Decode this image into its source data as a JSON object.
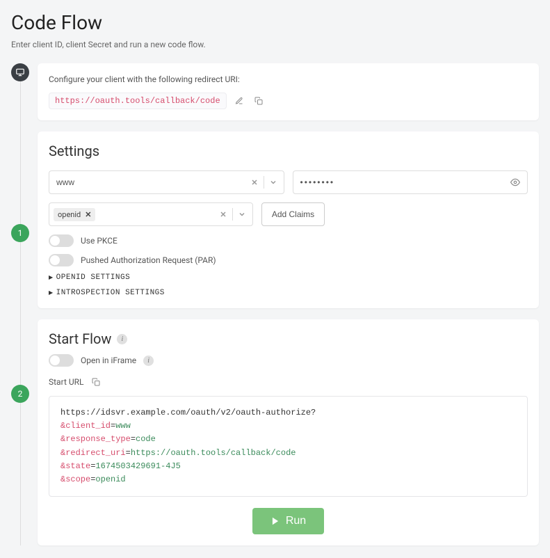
{
  "page": {
    "title": "Code Flow",
    "subtitle": "Enter client ID, client Secret and run a new code flow."
  },
  "step_config": {
    "hint": "Configure your client with the following redirect URI:",
    "redirect_uri": "https://oauth.tools/callback/code"
  },
  "settings": {
    "title": "Settings",
    "client_id": "www",
    "client_secret_mask": "••••••••",
    "scope_tag": "openid",
    "add_claims_label": "Add Claims",
    "toggles": {
      "pkce": "Use PKCE",
      "par": "Pushed Authorization Request (PAR)"
    },
    "expanders": {
      "openid": "OPENID SETTINGS",
      "introspection": "INTROSPECTION SETTINGS"
    }
  },
  "startflow": {
    "title": "Start Flow",
    "open_in_iframe": "Open in iFrame",
    "start_url_label": "Start URL",
    "url": {
      "base": "https://idsvr.example.com/oauth/v2/oauth-authorize?",
      "params": [
        {
          "k": "client_id",
          "v": "www"
        },
        {
          "k": "response_type",
          "v": "code"
        },
        {
          "k": "redirect_uri",
          "v": "https://oauth.tools/callback/code"
        },
        {
          "k": "state",
          "v": "1674503429691-4J5"
        },
        {
          "k": "scope",
          "v": "openid"
        }
      ]
    },
    "run_label": "Run"
  }
}
